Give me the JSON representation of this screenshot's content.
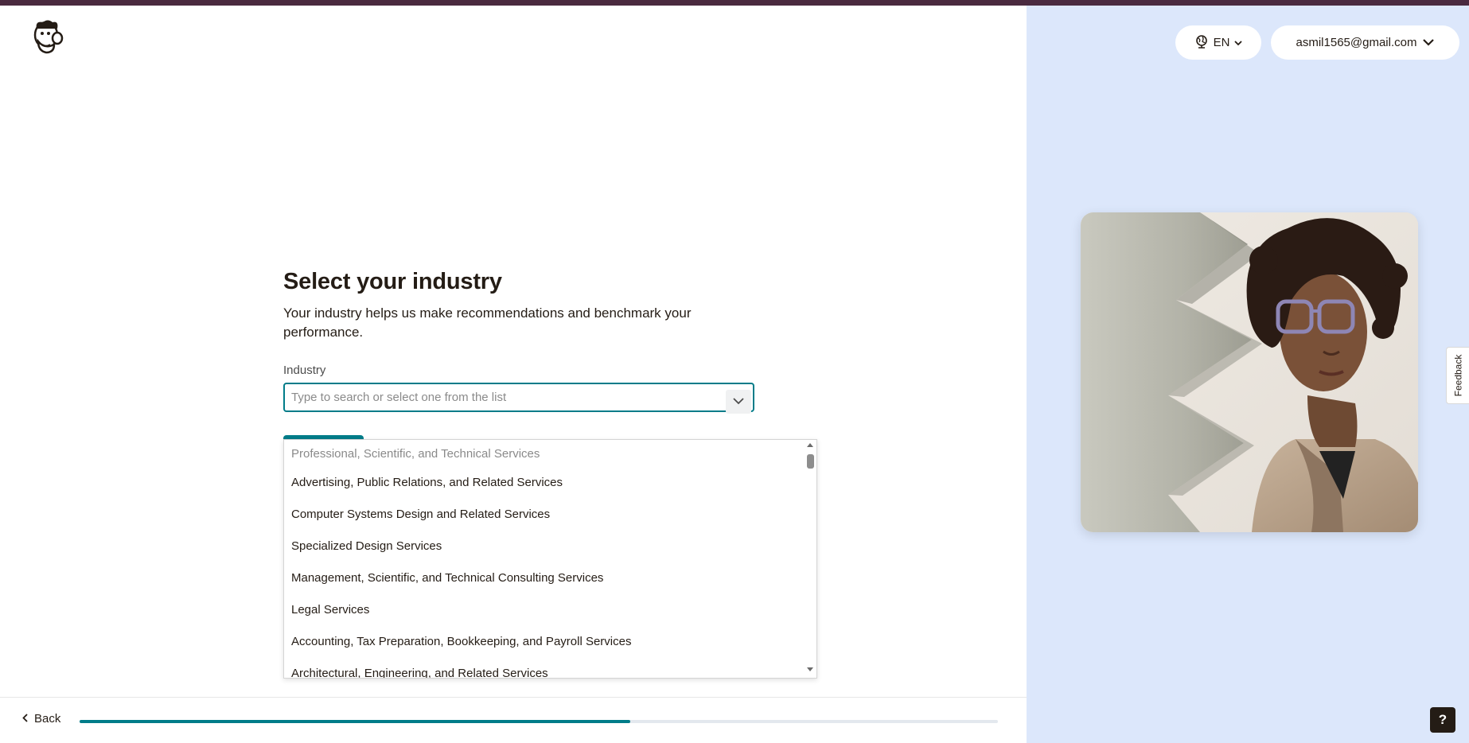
{
  "header": {
    "language": "EN",
    "account_email": "asmil1565@gmail.com"
  },
  "main": {
    "title": "Select your industry",
    "subtitle": "Your industry helps us make recommendations and benchmark your performance.",
    "field_label": "Industry",
    "industry_input": {
      "value": "",
      "placeholder": "Type to search or select one from the list"
    }
  },
  "dropdown": {
    "group_header": "Professional, Scientific, and Technical Services",
    "items": [
      "Advertising, Public Relations, and Related Services",
      "Computer Systems Design and Related Services",
      "Specialized Design Services",
      "Management, Scientific, and Technical Consulting Services",
      "Legal Services",
      "Accounting, Tax Preparation, Bookkeeping, and Payroll Services",
      "Architectural, Engineering, and Related Services"
    ]
  },
  "footer": {
    "back_label": "Back",
    "progress_fraction": 0.6
  },
  "side": {
    "feedback_label": "Feedback",
    "help_label": "?"
  },
  "colors": {
    "accent": "#007c89",
    "top_bar": "#4a2a3f",
    "side_panel": "#dce7fb",
    "dark": "#241c15"
  },
  "icons": {
    "logo": "mailchimp-freddie-logo",
    "language": "globe-icon",
    "chevron": "chevron-down-icon",
    "back": "chevron-left-icon"
  }
}
